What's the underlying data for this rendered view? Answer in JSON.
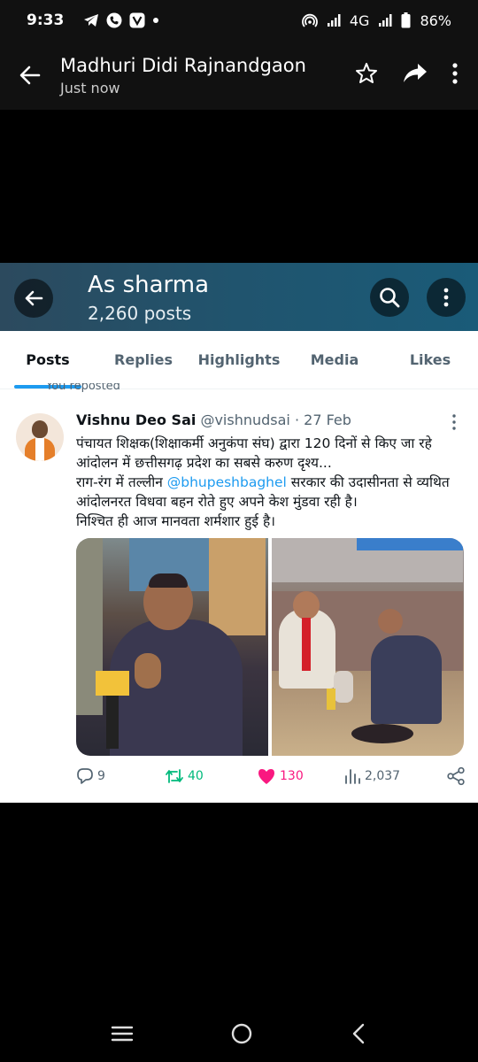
{
  "status_bar": {
    "time": "9:33",
    "network": "4G",
    "battery": "86%"
  },
  "chat_header": {
    "title": "Madhuri Didi Rajnandgaon",
    "subtitle": "Just now"
  },
  "profile": {
    "name": "As sharma",
    "posts_count": "2,260 posts"
  },
  "tabs": [
    {
      "label": "Posts",
      "active": true
    },
    {
      "label": "Replies",
      "active": false
    },
    {
      "label": "Highlights",
      "active": false
    },
    {
      "label": "Media",
      "active": false
    },
    {
      "label": "Likes",
      "active": false
    }
  ],
  "reposted_label": "You reposted",
  "tweet": {
    "author": "Vishnu Deo Sai",
    "handle": "@vishnudsai",
    "separator": "·",
    "date": "27 Feb",
    "line1": "पंचायत शिक्षक(शिक्षाकर्मी अनुकंपा संघ) द्वारा 120 दिनों से किए जा रहे",
    "line2": "आंदोलन में छत्तीसगढ़ प्रदेश का सबसे करुण दृश्य...",
    "line3_prefix": "राग-रंग में तल्लीन ",
    "line3_mention": "@bhupeshbaghel",
    "line3_suffix": " सरकार की उदासीनता से व्यथित",
    "line4": "आंदोलनरत विधवा बहन रोते हुए अपने केश मुंडवा रही है।",
    "line5": "निश्चित ही आज मानवता शर्मशार हुई है।",
    "stats": {
      "replies": "9",
      "reposts": "40",
      "likes": "130",
      "views": "2,037"
    }
  },
  "colors": {
    "accent": "#1d9bf0",
    "retweet": "#00ba7c",
    "like": "#f91880",
    "header_bg": "#20546e"
  }
}
